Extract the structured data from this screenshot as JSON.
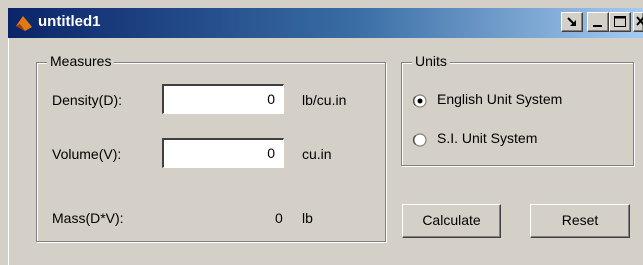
{
  "window": {
    "title": "untitled1",
    "icon": "matlab-logo-icon",
    "controls": [
      "dock-icon",
      "minimize-icon",
      "maximize-icon",
      "close-icon"
    ]
  },
  "measures": {
    "group_title": "Measures",
    "density": {
      "label": "Density(D):",
      "value": "0",
      "unit": "lb/cu.in"
    },
    "volume": {
      "label": "Volume(V):",
      "value": "0",
      "unit": "cu.in"
    },
    "mass": {
      "label": "Mass(D*V):",
      "value": "0",
      "unit": "lb"
    }
  },
  "units": {
    "group_title": "Units",
    "options": [
      {
        "label": "English Unit System",
        "selected": true
      },
      {
        "label": "S.I. Unit System",
        "selected": false
      }
    ]
  },
  "buttons": {
    "calculate": "Calculate",
    "reset": "Reset"
  },
  "colors": {
    "face": "#d4d0c8",
    "title_start": "#0a246a",
    "title_end": "#a6caf0"
  }
}
